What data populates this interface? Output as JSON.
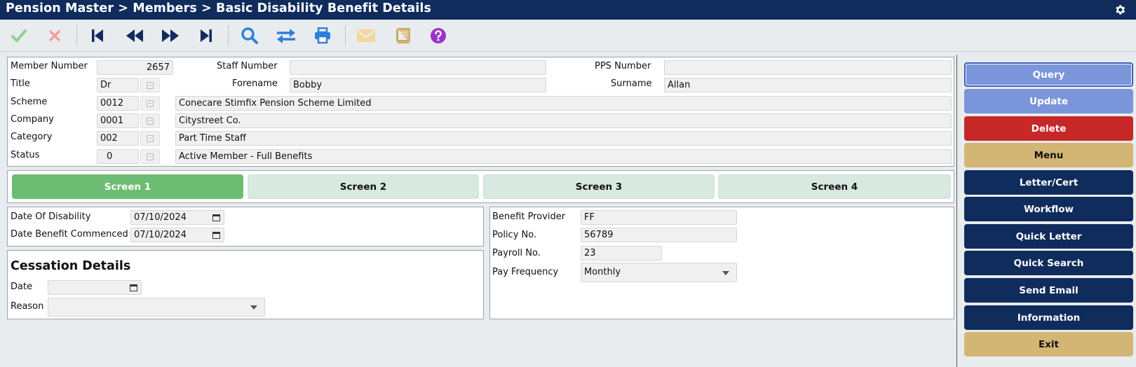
{
  "app": {
    "breadcrumb": "Pension Master > Members > Basic Disability Benefit Details"
  },
  "toolbar": {
    "buttons": [
      {
        "name": "accept",
        "icon": "check-icon"
      },
      {
        "name": "cancel",
        "icon": "close-icon"
      },
      {
        "name": "first",
        "icon": "first-record-icon"
      },
      {
        "name": "previous",
        "icon": "previous-record-icon"
      },
      {
        "name": "next",
        "icon": "next-record-icon"
      },
      {
        "name": "last",
        "icon": "last-record-icon"
      },
      {
        "name": "search",
        "icon": "search-icon"
      },
      {
        "name": "transfer",
        "icon": "swap-icon"
      },
      {
        "name": "print",
        "icon": "print-icon"
      },
      {
        "name": "email",
        "icon": "envelope-icon"
      },
      {
        "name": "notes",
        "icon": "book-icon"
      },
      {
        "name": "help",
        "icon": "help-icon"
      }
    ]
  },
  "member": {
    "member_number_label": "Member Number",
    "member_number": "2657",
    "staff_number_label": "Staff Number",
    "staff_number": "",
    "pps_number_label": "PPS Number",
    "pps_number": "",
    "title_label": "Title",
    "title": "Dr",
    "forename_label": "Forename",
    "forename": "Bobby",
    "surname_label": "Surname",
    "surname": "Allan",
    "scheme_label": "Scheme",
    "scheme_code": "0012",
    "scheme_name": "Conecare Stimfix Pension Scheme Limited",
    "company_label": "Company",
    "company_code": "0001",
    "company_name": "Citystreet Co.",
    "category_label": "Category",
    "category_code": "002",
    "category_name": "Part Time Staff",
    "status_label": "Status",
    "status_code": "0",
    "status_name": "Active Member - Full Benefits"
  },
  "tabs": [
    {
      "label": "Screen 1",
      "active": true
    },
    {
      "label": "Screen 2",
      "active": false
    },
    {
      "label": "Screen 3",
      "active": false
    },
    {
      "label": "Screen 4",
      "active": false
    }
  ],
  "disability": {
    "date_of_disability_label": "Date Of Disability",
    "date_of_disability": "07/10/2024",
    "date_benefit_commenced_label": "Date Benefit Commenced",
    "date_benefit_commenced": "07/10/2024"
  },
  "cessation": {
    "heading": "Cessation Details",
    "date_label": "Date",
    "date": "",
    "reason_label": "Reason",
    "reason": ""
  },
  "benefit": {
    "provider_label": "Benefit Provider",
    "provider": "FF",
    "policy_label": "Policy No.",
    "policy": "56789",
    "payroll_label": "Payroll No.",
    "payroll": "23",
    "pay_frequency_label": "Pay Frequency",
    "pay_frequency": "Monthly"
  },
  "sidebar": {
    "query": "Query",
    "update": "Update",
    "delete": "Delete",
    "menu": "Menu",
    "letter_cert": "Letter/Cert",
    "workflow": "Workflow",
    "quick_letter": "Quick Letter",
    "quick_search": "Quick Search",
    "send_email": "Send Email",
    "information": "Information",
    "exit": "Exit"
  },
  "colors": {
    "navy": "#0f2c5c",
    "active_tab": "#6cbd73",
    "inactive_tab": "#d7e9e0",
    "query_button": "#7b95da",
    "delete_button": "#c62828",
    "gold_button": "#d4b674"
  }
}
